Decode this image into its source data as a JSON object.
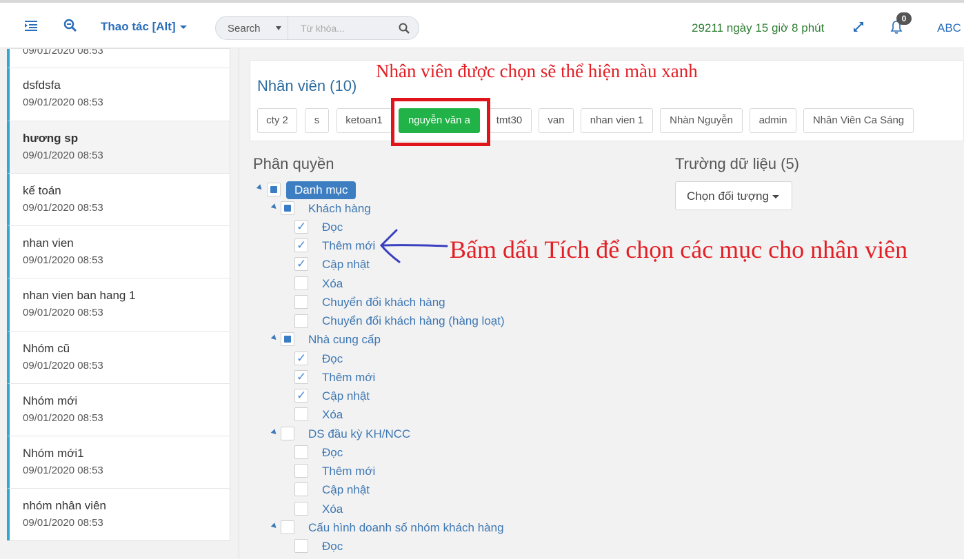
{
  "topbar": {
    "menu_label": "Thao tác [Alt]",
    "search_select": "Search",
    "search_placeholder": "Từ khóa...",
    "counter": "29211 ngày 15 giờ 8 phút",
    "notification_count": "0",
    "user": "ABC",
    "icons": [
      "list-indent-icon",
      "zoom-icon",
      "search-icon",
      "expand-icon",
      "bell-icon"
    ]
  },
  "sidebar": {
    "items": [
      {
        "name": "",
        "date": "09/01/2020 08:53"
      },
      {
        "name": "dsfdsfa",
        "date": "09/01/2020 08:53"
      },
      {
        "name": "hương sp",
        "date": "09/01/2020 08:53"
      },
      {
        "name": "kế toán",
        "date": "09/01/2020 08:53"
      },
      {
        "name": "nhan vien",
        "date": "09/01/2020 08:53"
      },
      {
        "name": "nhan vien ban hang 1",
        "date": "09/01/2020 08:53"
      },
      {
        "name": "Nhóm cũ",
        "date": "09/01/2020 08:53"
      },
      {
        "name": "Nhóm mới",
        "date": "09/01/2020 08:53"
      },
      {
        "name": "Nhóm mới1",
        "date": "09/01/2020 08:53"
      },
      {
        "name": "nhóm nhân viên",
        "date": "09/01/2020 08:53"
      }
    ]
  },
  "staff": {
    "title": "Nhân viên (10)",
    "annotation": "Nhân viên được chọn sẽ thể hiện màu xanh",
    "chips": [
      "cty 2",
      "s",
      "ketoan1",
      "nguyễn văn a",
      "tmt30",
      "van",
      "nhan vien 1",
      "Nhàn Nguyễn",
      "admin",
      "Nhân Viên Ca Sáng"
    ],
    "selected": "nguyễn văn a"
  },
  "permissions": {
    "title": "Phân quyền",
    "root": "Danh mục",
    "annotation": "Bấm dấu Tích để chọn các mục cho nhân viên",
    "groups": [
      {
        "label": "Khách hàng",
        "items": [
          {
            "label": "Đọc",
            "checked": true
          },
          {
            "label": "Thêm mới",
            "checked": true
          },
          {
            "label": "Cập nhật",
            "checked": true
          },
          {
            "label": "Xóa",
            "checked": false
          },
          {
            "label": "Chuyển đổi khách hàng",
            "checked": false
          },
          {
            "label": "Chuyển đổi khách hàng (hàng loạt)",
            "checked": false
          }
        ]
      },
      {
        "label": "Nhà cung cấp",
        "items": [
          {
            "label": "Đọc",
            "checked": true
          },
          {
            "label": "Thêm mới",
            "checked": true
          },
          {
            "label": "Cập nhật",
            "checked": true
          },
          {
            "label": "Xóa",
            "checked": false
          }
        ]
      },
      {
        "label": "DS đầu kỳ KH/NCC",
        "items": [
          {
            "label": "Đọc",
            "checked": false
          },
          {
            "label": "Thêm mới",
            "checked": false
          },
          {
            "label": "Cập nhật",
            "checked": false
          },
          {
            "label": "Xóa",
            "checked": false
          }
        ]
      },
      {
        "label": "Cấu hình doanh số nhóm khách hàng",
        "items": [
          {
            "label": "Đọc",
            "checked": false
          }
        ]
      }
    ]
  },
  "data_fields": {
    "title": "Trường dữ liệu (5)",
    "select_label": "Chọn đối tượng"
  },
  "colors": {
    "primary": "#2a6ebb",
    "selected_chip": "#22b348",
    "annotation_red": "#e21f25",
    "sidebar_accent": "#2fa8d0"
  }
}
